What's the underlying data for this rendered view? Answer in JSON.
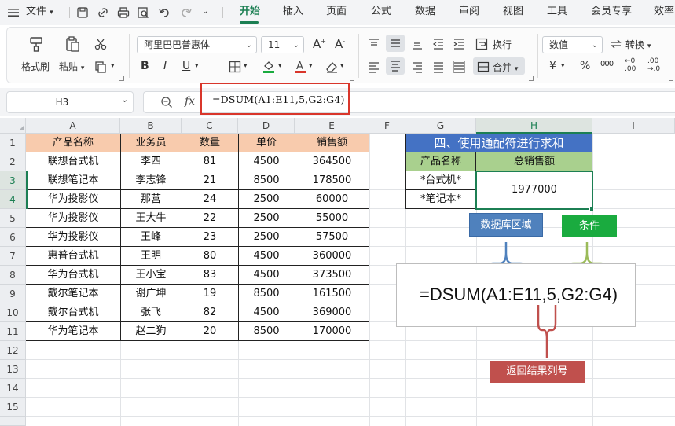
{
  "menubar": {
    "file_label": "文件",
    "tabs": [
      "开始",
      "插入",
      "页面",
      "公式",
      "数据",
      "审阅",
      "视图",
      "工具",
      "会员专享",
      "效率"
    ],
    "active_tab": "开始"
  },
  "ribbon": {
    "format_painter": "格式刷",
    "paste": "粘贴",
    "font_name": "阿里巴巴普惠体",
    "font_size": "11",
    "wrap_text": "换行",
    "merge": "合并",
    "number_format": "数值",
    "convert": "转换"
  },
  "formula_bar": {
    "cell_ref": "H3",
    "fx_label": "fx",
    "formula": "=DSUM(A1:E11,5,G2:G4)"
  },
  "columns": [
    "A",
    "B",
    "C",
    "D",
    "E",
    "F",
    "G",
    "H",
    "I"
  ],
  "rows": [
    "1",
    "2",
    "3",
    "4",
    "5",
    "6",
    "7",
    "8",
    "9",
    "10",
    "11",
    "12",
    "13",
    "14",
    "15"
  ],
  "table": {
    "headers": [
      "产品名称",
      "业务员",
      "数量",
      "单价",
      "销售额"
    ],
    "rows": [
      [
        "联想台式机",
        "李四",
        "81",
        "4500",
        "364500"
      ],
      [
        "联想笔记本",
        "李志锋",
        "21",
        "8500",
        "178500"
      ],
      [
        "华为投影仪",
        "那营",
        "24",
        "2500",
        "60000"
      ],
      [
        "华为投影仪",
        "王大牛",
        "22",
        "2500",
        "55000"
      ],
      [
        "华为投影仪",
        "王峰",
        "23",
        "2500",
        "57500"
      ],
      [
        "惠普台式机",
        "王明",
        "80",
        "4500",
        "360000"
      ],
      [
        "华为台式机",
        "王小宝",
        "83",
        "4500",
        "373500"
      ],
      [
        "戴尔笔记本",
        "谢广坤",
        "19",
        "8500",
        "161500"
      ],
      [
        "戴尔台式机",
        "张飞",
        "82",
        "4500",
        "369000"
      ],
      [
        "华为笔记本",
        "赵二狗",
        "20",
        "8500",
        "170000"
      ]
    ]
  },
  "criteria": {
    "title": "四、使用通配符进行求和",
    "col1_header": "产品名称",
    "col2_header": "总销售额",
    "item1": "*台式机*",
    "item2": "*笔记本*",
    "result": "1977000"
  },
  "annotations": {
    "database_label": "数据库区域",
    "condition_label": "条件",
    "formula_display": "=DSUM(A1:E11,5,G2:G4)",
    "return_column_label": "返回结果列号"
  },
  "colors": {
    "header_fill": "#f8cbad",
    "title_fill": "#4472c4",
    "criteria_header_fill": "#a9d08e",
    "accent_green": "#1c7f53",
    "callout_blue": "#4f81bd",
    "callout_green": "#1aab3f",
    "callout_red": "#c0504d",
    "bracket_blue": "#4f81bd",
    "bracket_green": "#9bbb59",
    "bracket_red": "#c0504d",
    "highlight_red": "#d9362b"
  }
}
